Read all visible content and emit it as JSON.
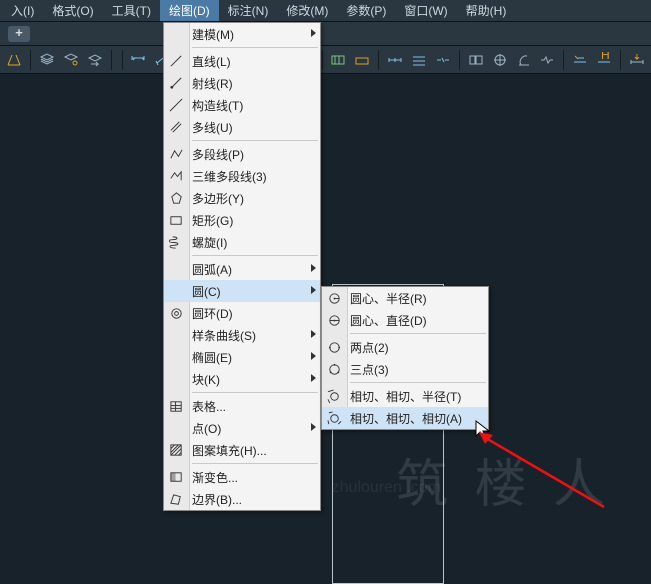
{
  "menubar": {
    "items": [
      {
        "label": "入(I)"
      },
      {
        "label": "格式(O)"
      },
      {
        "label": "工具(T)"
      },
      {
        "label": "绘图(D)",
        "active": true
      },
      {
        "label": "标注(N)"
      },
      {
        "label": "修改(M)"
      },
      {
        "label": "参数(P)"
      },
      {
        "label": "窗口(W)"
      },
      {
        "label": "帮助(H)"
      }
    ]
  },
  "tabbar": {
    "plus": "+"
  },
  "dropdown": {
    "items": [
      {
        "icon": "",
        "label": "建模(M)",
        "arrow": true
      },
      {
        "sep": true
      },
      {
        "icon": "line",
        "label": "直线(L)"
      },
      {
        "icon": "ray",
        "label": "射线(R)"
      },
      {
        "icon": "xline",
        "label": "构造线(T)"
      },
      {
        "icon": "mline",
        "label": "多线(U)"
      },
      {
        "sep": true
      },
      {
        "icon": "pline",
        "label": "多段线(P)"
      },
      {
        "icon": "3dpoly",
        "label": "三维多段线(3)"
      },
      {
        "icon": "polygon",
        "label": "多边形(Y)"
      },
      {
        "icon": "rect",
        "label": "矩形(G)"
      },
      {
        "icon": "helix",
        "label": "螺旋(I)"
      },
      {
        "sep": true
      },
      {
        "icon": "",
        "label": "圆弧(A)",
        "arrow": true
      },
      {
        "icon": "",
        "label": "圆(C)",
        "arrow": true,
        "highlight": true
      },
      {
        "icon": "donut",
        "label": "圆环(D)"
      },
      {
        "icon": "",
        "label": "样条曲线(S)",
        "arrow": true
      },
      {
        "icon": "",
        "label": "椭圆(E)",
        "arrow": true
      },
      {
        "icon": "",
        "label": "块(K)",
        "arrow": true
      },
      {
        "sep": true
      },
      {
        "icon": "table",
        "label": "表格..."
      },
      {
        "icon": "",
        "label": "点(O)",
        "arrow": true
      },
      {
        "icon": "hatch",
        "label": "图案填充(H)..."
      },
      {
        "sep": true
      },
      {
        "icon": "gradient",
        "label": "渐变色..."
      },
      {
        "icon": "boundary",
        "label": "边界(B)..."
      }
    ]
  },
  "submenu": {
    "items": [
      {
        "icon": "c-cr",
        "label": "圆心、半径(R)"
      },
      {
        "icon": "c-cd",
        "label": "圆心、直径(D)"
      },
      {
        "sep": true
      },
      {
        "icon": "c-2p",
        "label": "两点(2)"
      },
      {
        "icon": "c-3p",
        "label": "三点(3)"
      },
      {
        "sep": true
      },
      {
        "icon": "c-ttr",
        "label": "相切、相切、半径(T)"
      },
      {
        "icon": "c-tta",
        "label": "相切、相切、相切(A)",
        "highlight": true
      }
    ]
  },
  "watermark": {
    "big": "筑 楼 人",
    "small": "zhulouren .com"
  }
}
